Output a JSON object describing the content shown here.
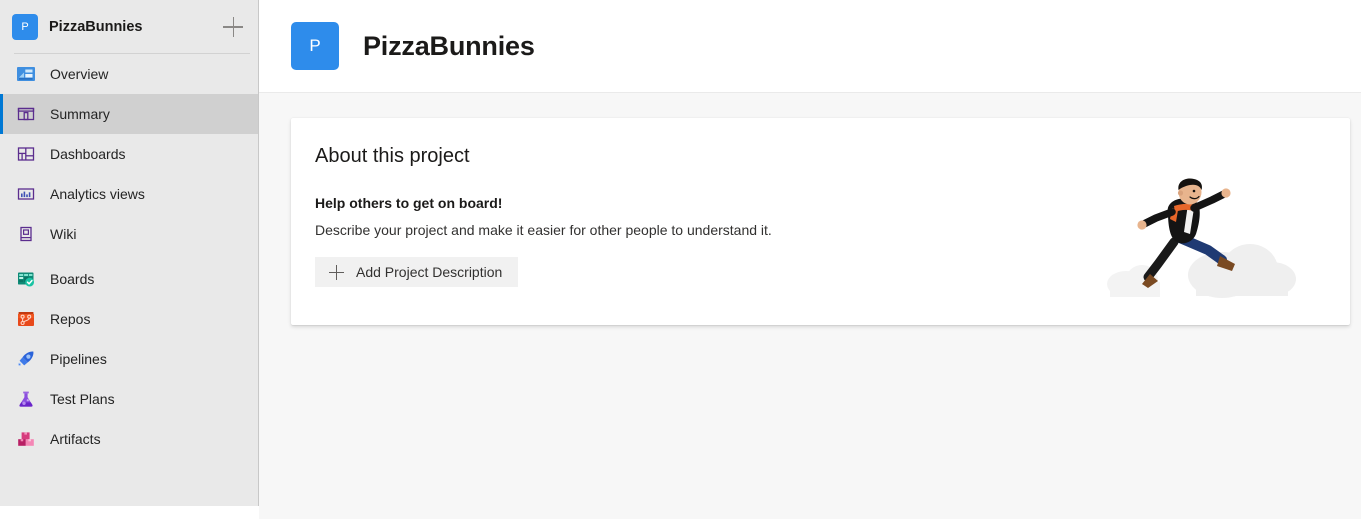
{
  "sidebar": {
    "project": {
      "avatar_letter": "P",
      "name": "PizzaBunnies",
      "avatar_color": "#2e8ceb",
      "add_label": "+"
    },
    "items": [
      {
        "label": "Overview",
        "icon": "overview-icon",
        "selected": false,
        "level": "top"
      },
      {
        "label": "Summary",
        "icon": "summary-icon",
        "selected": true,
        "level": "sub"
      },
      {
        "label": "Dashboards",
        "icon": "dashboards-icon",
        "selected": false,
        "level": "sub"
      },
      {
        "label": "Analytics views",
        "icon": "analytics-views-icon",
        "selected": false,
        "level": "sub"
      },
      {
        "label": "Wiki",
        "icon": "wiki-icon",
        "selected": false,
        "level": "sub"
      },
      {
        "label": "Boards",
        "icon": "boards-icon",
        "selected": false,
        "level": "top"
      },
      {
        "label": "Repos",
        "icon": "repos-icon",
        "selected": false,
        "level": "top"
      },
      {
        "label": "Pipelines",
        "icon": "pipelines-icon",
        "selected": false,
        "level": "top"
      },
      {
        "label": "Test Plans",
        "icon": "test-plans-icon",
        "selected": false,
        "level": "top"
      },
      {
        "label": "Artifacts",
        "icon": "artifacts-icon",
        "selected": false,
        "level": "top"
      }
    ]
  },
  "header": {
    "avatar_letter": "P",
    "title": "PizzaBunnies"
  },
  "about_card": {
    "title": "About this project",
    "subtitle": "Help others to get on board!",
    "description": "Describe your project and make it easier for other people to understand it.",
    "button_label": "Add Project Description",
    "illustration": "running-man-on-clouds-illustration"
  },
  "colors": {
    "accent": "#0078d4",
    "avatar_blue": "#2e8ceb",
    "sidebar_bg": "#e9e9e9",
    "selected_bg": "#d0d0d0",
    "page_bg": "#f7f7f7",
    "card_bg": "#ffffff"
  }
}
